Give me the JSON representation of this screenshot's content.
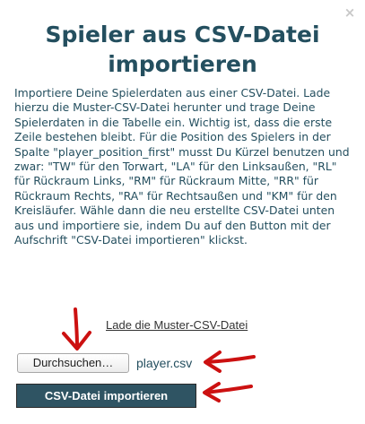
{
  "dialog": {
    "close_icon": "×",
    "title_line1": "Spieler aus CSV-Datei",
    "title_line2": "importieren",
    "description": "Importiere Deine Spielerdaten aus einer CSV-Datei. Lade hierzu die Muster-CSV-Datei herunter und trage Deine Spielerdaten in die Tabelle ein. Wichtig ist, dass die erste Zeile bestehen bleibt. Für die Position des Spielers in der Spalte \"player_position_first\" musst Du Kürzel benutzen und zwar: \"TW\" für den Torwart, \"LA\" für den Linksaußen, \"RL\" für Rückraum Links, \"RM\" für Rückraum Mitte, \"RR\" für Rückraum Rechts, \"RA\" für Rechtsaußen und \"KM\" für den Kreisläufer. Wähle dann die neu erstellte CSV-Datei unten aus und importiere sie, indem Du auf den Button mit der Aufschrift \"CSV-Datei importieren\" klickst.",
    "download_link": "Lade die Muster-CSV-Datei",
    "file_button": "Durchsuchen…",
    "file_name": "player.csv",
    "import_button": "CSV-Datei importieren"
  },
  "annotations": {
    "arrow_color": "#cc1111"
  },
  "colors": {
    "text": "#244f5f",
    "button_bg": "#2f5463"
  }
}
